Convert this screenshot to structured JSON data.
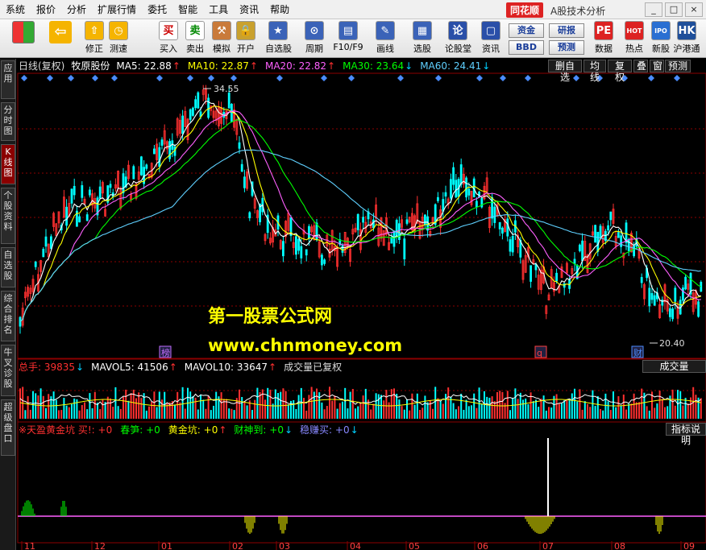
{
  "menu": [
    "系统",
    "报价",
    "分析",
    "扩展行情",
    "委托",
    "智能",
    "工具",
    "资讯",
    "帮助"
  ],
  "brand": {
    "logo": "同花顺",
    "title": "A股技术分析"
  },
  "window_buttons": [
    "_",
    "□",
    "×"
  ],
  "toolbar": {
    "buttons": [
      {
        "label": "修正",
        "icon": "⇧"
      },
      {
        "label": "测速",
        "icon": "◷"
      },
      {
        "label": "买入",
        "icon": "买"
      },
      {
        "label": "卖出",
        "icon": "卖"
      },
      {
        "label": "模拟",
        "icon": "⚒"
      },
      {
        "label": "开户",
        "icon": "🔒"
      },
      {
        "label": "自选股",
        "icon": "★"
      },
      {
        "label": "周期",
        "icon": "⊙"
      },
      {
        "label": "F10/F9",
        "icon": "▤"
      },
      {
        "label": "画线",
        "icon": "✎"
      },
      {
        "label": "选股",
        "icon": "▦"
      },
      {
        "label": "论股堂",
        "icon": "论"
      },
      {
        "label": "资讯",
        "icon": "▢"
      },
      {
        "label": "数据",
        "icon": "PE"
      },
      {
        "label": "热点",
        "icon": "HOT"
      },
      {
        "label": "新股",
        "icon": "IPO"
      },
      {
        "label": "沪港通",
        "icon": "HK"
      }
    ],
    "small_buttons": [
      "资金",
      "研报",
      "BBD",
      "预测"
    ]
  },
  "left_tabs": [
    {
      "label": "应用",
      "active": false
    },
    {
      "label": "分时图",
      "active": false
    },
    {
      "label": "K线图",
      "active": true
    },
    {
      "label": "个股资料",
      "active": false
    },
    {
      "label": "自选股",
      "active": false
    },
    {
      "label": "综合排名",
      "active": false
    },
    {
      "label": "牛叉诊股",
      "active": false
    },
    {
      "label": "超级盘口",
      "active": false
    }
  ],
  "kline_header": {
    "period": "日线(复权)",
    "stock": "牧原股份",
    "ma": [
      {
        "label": "MA5: 22.88",
        "arrow": "↑",
        "color": "#ffffff",
        "arrow_color": "#ff3030"
      },
      {
        "label": "MA10: 22.87",
        "arrow": "↑",
        "color": "#ffff00",
        "arrow_color": "#ff3030"
      },
      {
        "label": "MA20: 22.82",
        "arrow": "↑",
        "color": "#ff60ff",
        "arrow_color": "#ff3030"
      },
      {
        "label": "MA30: 23.64",
        "arrow": "↓",
        "color": "#00ff00",
        "arrow_color": "#00d0ff"
      },
      {
        "label": "MA60: 24.41",
        "arrow": "↓",
        "color": "#5fd0ff",
        "arrow_color": "#00d0ff"
      }
    ],
    "right_buttons": [
      "删自选",
      "均线",
      "复权",
      "叠",
      "窗",
      "预测"
    ]
  },
  "kline": {
    "high_label": "34.55",
    "low_label": "20.40",
    "markers": [
      "榜",
      "q",
      "财"
    ]
  },
  "volume_header": {
    "items": [
      {
        "label": "总手: 39835",
        "arrow": "↓",
        "color": "#ff3030",
        "arrow_color": "#00d0ff"
      },
      {
        "label": "MAVOL5: 41506",
        "arrow": "↑",
        "color": "#ffffff",
        "arrow_color": "#ff3030"
      },
      {
        "label": "MAVOL10: 33647",
        "arrow": "↑",
        "color": "#ffffff",
        "arrow_color": "#ff3030"
      },
      {
        "label": "成交量已复权",
        "arrow": "",
        "color": "#dddddd",
        "arrow_color": "#dddddd"
      }
    ],
    "button": "成交量"
  },
  "indicator_header": {
    "items": [
      {
        "label": "※天盈黄金坑 买!: +0",
        "arrow": "",
        "color": "#ff3030",
        "arrow_color": "#ff3030"
      },
      {
        "label": "春笋: +0",
        "arrow": "",
        "color": "#00ff00",
        "arrow_color": "#00ff00"
      },
      {
        "label": "黄金坑: +0",
        "arrow": "↑",
        "color": "#ffff00",
        "arrow_color": "#ff3030"
      },
      {
        "label": "财神到: +0",
        "arrow": "↓",
        "color": "#00ff00",
        "arrow_color": "#00d0ff"
      },
      {
        "label": "稳赚买: +0",
        "arrow": "↓",
        "color": "#8888ff",
        "arrow_color": "#00d0ff"
      }
    ],
    "button": "指标说明"
  },
  "x_axis": [
    "11",
    "12",
    "01",
    "02",
    "03",
    "04",
    "05",
    "06",
    "07",
    "08",
    "09"
  ],
  "watermark": {
    "line1": "第一股票公式网",
    "line2": "www.chnmoney.com"
  },
  "colors": {
    "up": "#ff3030",
    "down": "#00ffff",
    "ma5": "#ffffff",
    "ma10": "#ffff00",
    "ma20": "#ff60ff",
    "ma30": "#00ff00",
    "ma60": "#5fd0ff",
    "grid": "#8b0000"
  }
}
